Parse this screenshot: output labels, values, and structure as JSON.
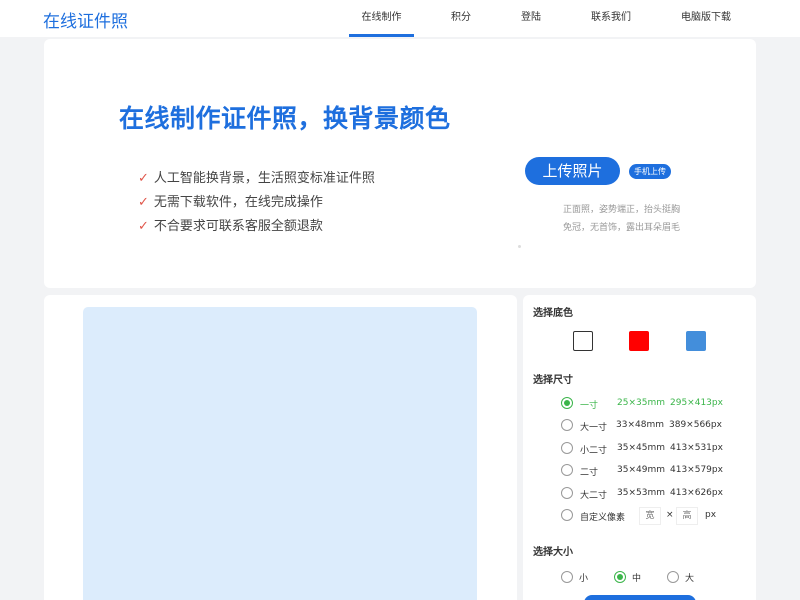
{
  "header": {
    "logo": "在线证件照",
    "nav": [
      "在线制作",
      "积分",
      "登陆",
      "联系我们",
      "电脑版下载"
    ],
    "active_index": 0
  },
  "hero": {
    "title": "在线制作证件照，换背景颜色",
    "features": [
      "人工智能换背景，生活照变标准证件照",
      "无需下载软件，在线完成操作",
      "不合要求可联系客服全额退款"
    ],
    "upload_label": "上传照片",
    "mobile_upload_label": "手机上传",
    "tips": [
      "正面照，姿势端正，抬头挺胸",
      "免冠，无首饰，露出耳朵眉毛"
    ],
    "colors": {
      "accent": "#1e6fde",
      "check": "#e0564a"
    }
  },
  "preview": {
    "background": "#dcecfc"
  },
  "settings": {
    "bg_title": "选择底色",
    "bg_colors": [
      {
        "name": "white",
        "hex": "#ffffff"
      },
      {
        "name": "red",
        "hex": "#ff0000"
      },
      {
        "name": "blue",
        "hex": "#438edb"
      }
    ],
    "size_title": "选择尺寸",
    "sizes": [
      {
        "name": "一寸",
        "mm": "25×35mm",
        "px": "295×413px",
        "selected": true
      },
      {
        "name": "大一寸",
        "mm": "33×48mm",
        "px": "389×566px",
        "selected": false
      },
      {
        "name": "小二寸",
        "mm": "35×45mm",
        "px": "413×531px",
        "selected": false
      },
      {
        "name": "二寸",
        "mm": "35×49mm",
        "px": "413×579px",
        "selected": false
      },
      {
        "name": "大二寸",
        "mm": "35×53mm",
        "px": "413×626px",
        "selected": false
      }
    ],
    "custom": {
      "label": "自定义像素",
      "width_placeholder": "宽",
      "height_placeholder": "高",
      "times": "×",
      "unit": "px"
    },
    "scale_title": "选择大小",
    "scales": [
      {
        "label": "小",
        "selected": false
      },
      {
        "label": "中",
        "selected": true
      },
      {
        "label": "大",
        "selected": false
      }
    ],
    "selected_color": "#3bb54a"
  }
}
